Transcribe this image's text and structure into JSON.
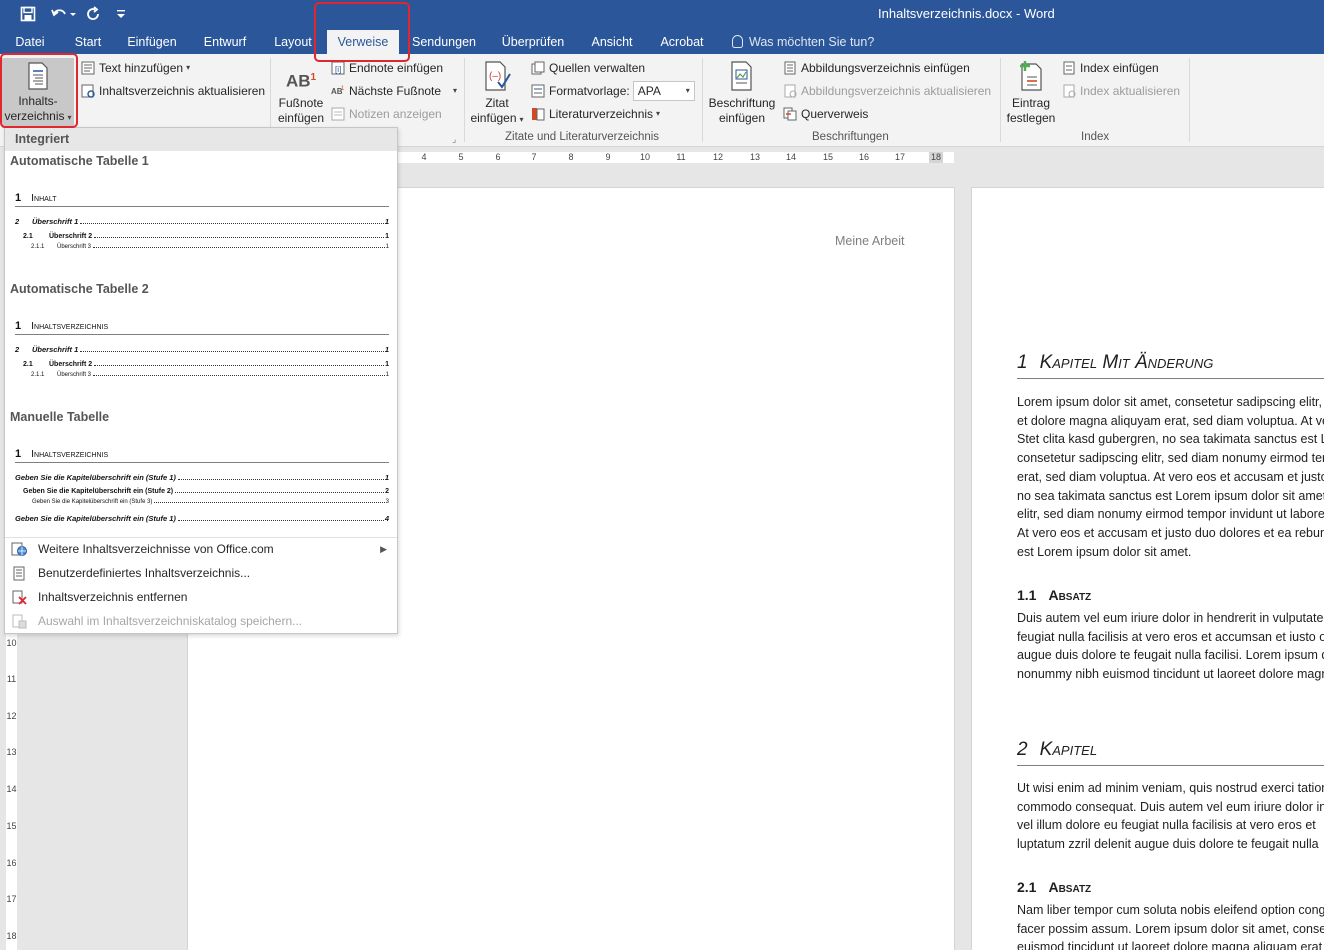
{
  "window": {
    "title": "Inhaltsverzeichnis.docx - Word"
  },
  "tabs": [
    {
      "id": "datei",
      "label": "Datei"
    },
    {
      "id": "start",
      "label": "Start"
    },
    {
      "id": "einfuegen",
      "label": "Einfügen"
    },
    {
      "id": "entwurf",
      "label": "Entwurf"
    },
    {
      "id": "layout",
      "label": "Layout"
    },
    {
      "id": "verweise",
      "label": "Verweise",
      "active": true
    },
    {
      "id": "sendungen",
      "label": "Sendungen"
    },
    {
      "id": "ueberpruefen",
      "label": "Überprüfen"
    },
    {
      "id": "ansicht",
      "label": "Ansicht"
    },
    {
      "id": "acrobat",
      "label": "Acrobat"
    }
  ],
  "tellme": {
    "label": "Was möchten Sie tun?"
  },
  "ribbon": {
    "toc": {
      "label_line1": "Inhalts-",
      "label_line2": "verzeichnis"
    },
    "text_hinzufuegen": "Text hinzufügen",
    "toc_aktualisieren": "Inhaltsverzeichnis aktualisieren",
    "fussnote": {
      "line1": "Fußnote",
      "line2": "einfügen",
      "icon_text": "AB",
      "sup": "1"
    },
    "endnote": "Endnote einfügen",
    "naechste_fussnote": "Nächste Fußnote",
    "notizen": "Notizen anzeigen",
    "zitat": {
      "line1": "Zitat",
      "line2": "einfügen"
    },
    "quellen": "Quellen verwalten",
    "formatvorlage_label": "Formatvorlage:",
    "formatvorlage_value": "APA",
    "literatur": "Literaturverzeichnis",
    "group_zitate": "Zitate und Literaturverzeichnis",
    "beschriftung": {
      "line1": "Beschriftung",
      "line2": "einfügen"
    },
    "abb_einfuegen": "Abbildungsverzeichnis einfügen",
    "abb_aktualisieren": "Abbildungsverzeichnis aktualisieren",
    "querverweis": "Querverweis",
    "group_beschriftungen": "Beschriftungen",
    "eintrag": {
      "line1": "Eintrag",
      "line2": "festlegen"
    },
    "index_einfuegen": "Index einfügen",
    "index_aktualisieren": "Index aktualisieren",
    "group_index": "Index"
  },
  "ruler": {
    "h_labels": [
      "4",
      "5",
      "6",
      "7",
      "8",
      "9",
      "10",
      "11",
      "12",
      "13",
      "14",
      "15",
      "16",
      "17",
      "18"
    ],
    "v_labels": [
      "10",
      "11",
      "12",
      "13",
      "14",
      "15",
      "16",
      "17",
      "18"
    ]
  },
  "dropdown": {
    "header": "Integriert",
    "sections": [
      {
        "title": "Automatische Tabelle 1",
        "heading_num": "1",
        "heading": "Inhalt",
        "lines": [
          {
            "level": 1,
            "num": "2",
            "text": "Überschrift 1",
            "page": "1"
          },
          {
            "level": 2,
            "num": "2.1",
            "text": "Überschrift 2",
            "page": "1"
          },
          {
            "level": 3,
            "num": "2.1.1",
            "text": "Überschrift 3",
            "page": "1"
          }
        ]
      },
      {
        "title": "Automatische Tabelle 2",
        "heading_num": "1",
        "heading": "Inhaltsverzeichnis",
        "lines": [
          {
            "level": 1,
            "num": "2",
            "text": "Überschrift 1",
            "page": "1"
          },
          {
            "level": 2,
            "num": "2.1",
            "text": "Überschrift 2",
            "page": "1"
          },
          {
            "level": 3,
            "num": "2.1.1",
            "text": "Überschrift 3",
            "page": "1"
          }
        ]
      },
      {
        "title": "Manuelle Tabelle",
        "heading_num": "1",
        "heading": "Inhaltsverzeichnis",
        "lines": [
          {
            "level": 1,
            "num": "",
            "text": "Geben Sie die Kapitelüberschrift ein (Stufe 1)",
            "page": "1"
          },
          {
            "level": 2,
            "num": "",
            "text": "Geben Sie die Kapitelüberschrift ein (Stufe 2)",
            "page": "2"
          },
          {
            "level": 3,
            "num": "",
            "text": "Geben Sie die Kapitelüberschrift ein (Stufe 3)",
            "page": "3"
          },
          {
            "level": 1,
            "num": "",
            "text": "Geben Sie die Kapitelüberschrift ein (Stufe 1)",
            "page": "4"
          }
        ]
      }
    ],
    "menu": [
      {
        "id": "weitere",
        "label": "Weitere Inhaltsverzeichnisse von Office.com",
        "submenu": true,
        "disabled": false
      },
      {
        "id": "benutzer",
        "label": "Benutzerdefiniertes Inhaltsverzeichnis...",
        "disabled": false
      },
      {
        "id": "entfernen",
        "label": "Inhaltsverzeichnis entfernen",
        "disabled": false
      },
      {
        "id": "auswahl",
        "label": "Auswahl im Inhaltsverzeichniskatalog speichern...",
        "disabled": true
      }
    ]
  },
  "document": {
    "header_text": "Meine Arbeit",
    "h1a": {
      "num": "1",
      "text": "Kapitel Mit Änderung"
    },
    "p1": [
      "Lorem ipsum dolor sit amet, consetetur sadipscing elitr, sed diam",
      "et dolore magna aliquyam erat, sed diam voluptua. At vero eos",
      "Stet clita kasd gubergren, no sea takimata sanctus est Lorem",
      "consetetur sadipscing elitr, sed diam nonumy eirmod tempor",
      "erat, sed diam voluptua. At vero eos et accusam et justo duo",
      "no sea takimata sanctus est Lorem ipsum dolor sit amet. Lorem",
      "elitr, sed diam nonumy eirmod tempor invidunt ut labore et",
      "At vero eos et accusam et justo duo dolores et ea rebum. Stet",
      "est Lorem ipsum dolor sit amet."
    ],
    "h2a": {
      "num": "1.1",
      "text": "Absatz"
    },
    "p2": [
      "Duis autem vel eum iriure dolor in hendrerit in vulputate velit",
      "feugiat nulla facilisis at vero eros et accumsan et iusto odio",
      "augue duis dolore te feugait nulla facilisi. Lorem ipsum dolor",
      "nonummy nibh euismod tincidunt ut laoreet dolore magna"
    ],
    "h1b": {
      "num": "2",
      "text": "Kapitel"
    },
    "p3": [
      "Ut wisi enim ad minim veniam, quis nostrud exerci tation",
      "commodo consequat. Duis autem vel eum iriure dolor in hendrerit",
      "vel illum dolore eu feugiat nulla facilisis at vero eros et",
      "luptatum zzril delenit augue duis dolore te feugait nulla"
    ],
    "h2b": {
      "num": "2.1",
      "text": "Absatz"
    },
    "p4": [
      "Nam liber tempor cum soluta nobis eleifend option congue",
      "facer possim assum. Lorem ipsum dolor sit amet, consectetuer",
      "euismod tincidunt ut laoreet dolore magna aliquam erat"
    ]
  },
  "colors": {
    "accent": "#2b579a",
    "highlight": "#e0262e"
  }
}
